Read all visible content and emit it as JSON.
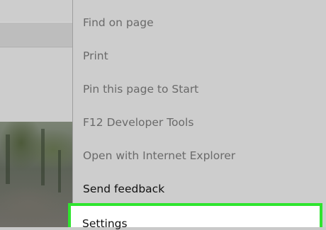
{
  "menu": {
    "items": [
      {
        "label": "Find on page"
      },
      {
        "label": "Print"
      },
      {
        "label": "Pin this page to Start"
      },
      {
        "label": "F12 Developer Tools"
      },
      {
        "label": "Open with Internet Explorer"
      },
      {
        "label": "Send feedback"
      }
    ],
    "settings": {
      "label": "Settings"
    }
  },
  "colors": {
    "menu_background": "#cdcdcd",
    "highlight_border": "#2ee52e",
    "highlight_fill": "#ffffff",
    "muted_text": "#6a6a6a",
    "strong_text": "#111111"
  }
}
